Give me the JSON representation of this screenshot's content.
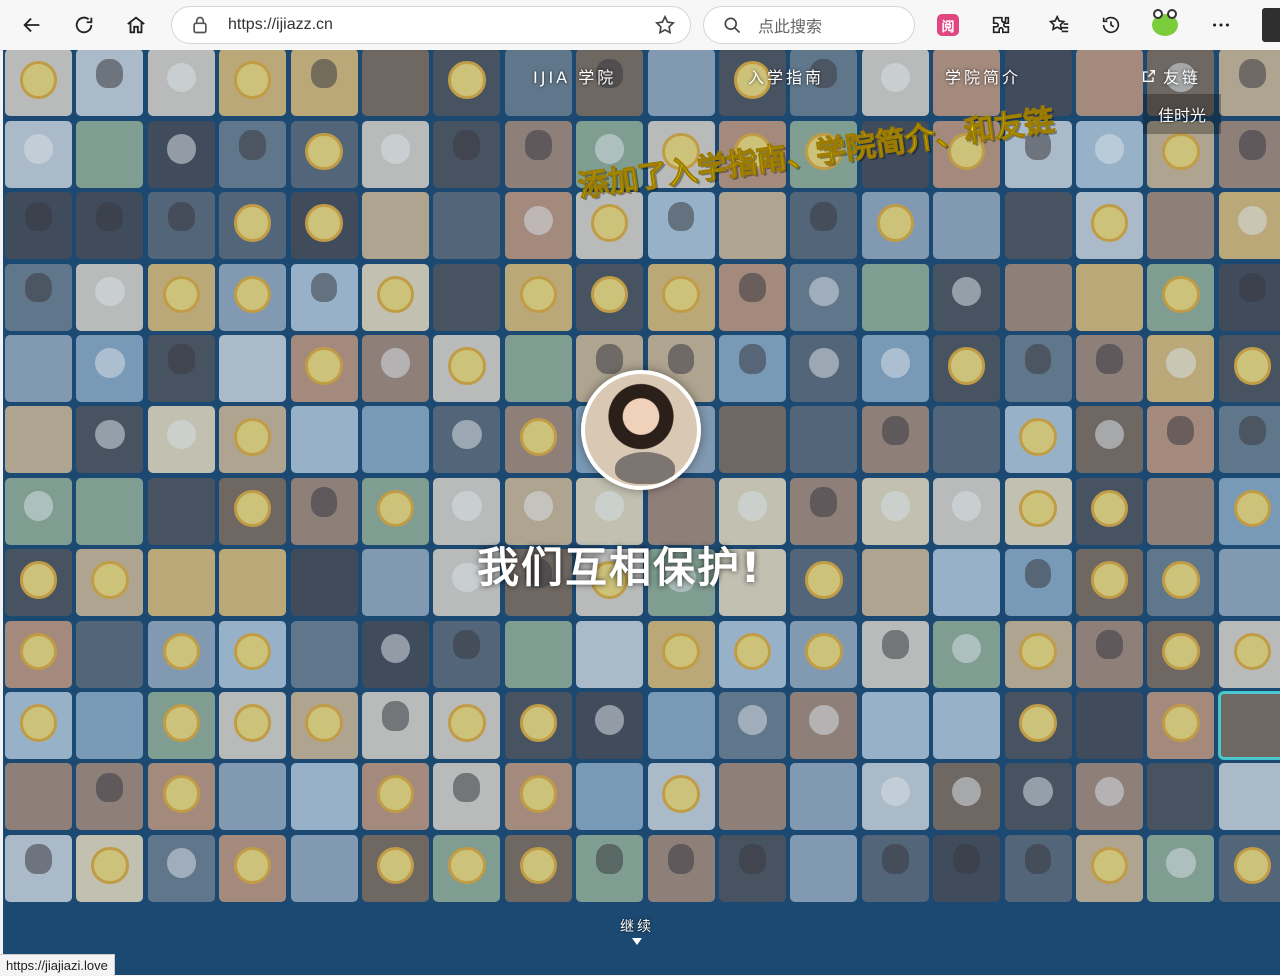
{
  "browser": {
    "url": "https://ijiazz.cn",
    "search_placeholder": "点此搜索",
    "extension_badge": "阅"
  },
  "nav": {
    "logo": "IJIA 学院",
    "guide": "入学指南",
    "intro": "学院简介",
    "links": "友链",
    "dropdown_item": "佳时光"
  },
  "headline": "添加了入学指南、学院简介、和友链",
  "slogan": "我们互相保护!",
  "continue_label": "继续",
  "status_url": "https://jiajiazi.love",
  "colors": {
    "page_background": "#1d4a72",
    "headline": "#ffe800",
    "highlight_tile_border": "#46e0e0"
  },
  "icons": [
    "back-icon",
    "refresh-icon",
    "home-icon",
    "lock-icon",
    "favorite-star-icon",
    "search-icon",
    "extension-icon",
    "puzzle-icon",
    "favorites-list-icon",
    "history-icon",
    "frog-profile-icon",
    "more-icon",
    "external-link-icon",
    "down-arrow-icon"
  ]
}
